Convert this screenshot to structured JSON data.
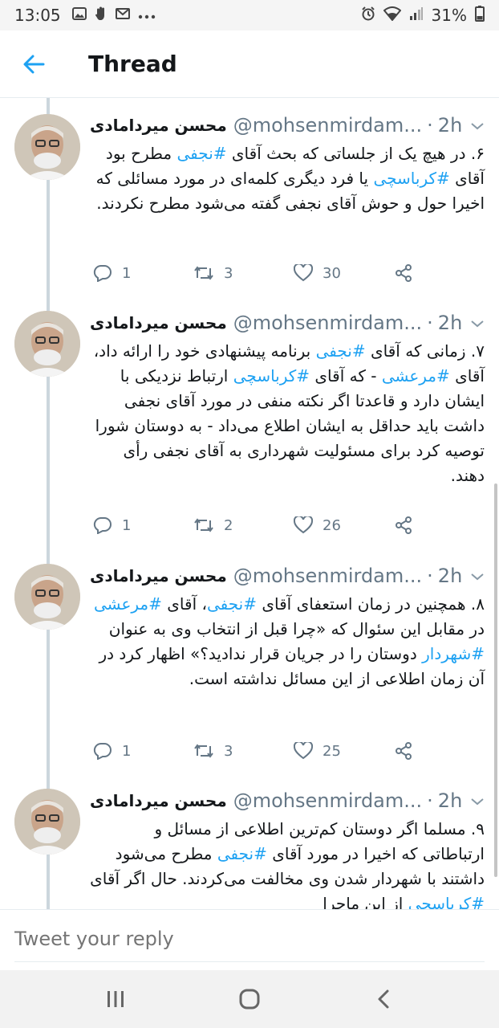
{
  "status_bar": {
    "time": "13:05",
    "battery": "31%",
    "left_icons": [
      "image-icon",
      "hand-icon",
      "gmail-icon",
      "more-icon"
    ],
    "right_icons": [
      "alarm-icon",
      "wifi-icon",
      "signal-icon",
      "battery-icon"
    ]
  },
  "header": {
    "title": "Thread"
  },
  "tweets": [
    {
      "display_name": "محسن میردامادی",
      "handle": "@mohsenmirdam...",
      "separator": "·",
      "time_ago": "2h",
      "segments": [
        {
          "text": "۶. در هیچ یک از جلساتی که بحث آقای ",
          "hashtag": false
        },
        {
          "text": "#نجفی",
          "hashtag": true
        },
        {
          "text": " مطرح بود آقای ",
          "hashtag": false
        },
        {
          "text": "#کرباسچی",
          "hashtag": true
        },
        {
          "text": " یا فرد دیگری کلمه‌ای در مورد مسائلی که اخیرا حول و حوش آقای نجفی گفته می‌شود مطرح نکردند.",
          "hashtag": false
        }
      ],
      "replies": "1",
      "retweets": "3",
      "likes": "30"
    },
    {
      "display_name": "محسن میردامادی",
      "handle": "@mohsenmirdam...",
      "separator": "·",
      "time_ago": "2h",
      "segments": [
        {
          "text": "۷. زمانی که آقای ",
          "hashtag": false
        },
        {
          "text": "#نجفی",
          "hashtag": true
        },
        {
          "text": " برنامه پیشنهادی خود را ارائه داد، آقای ",
          "hashtag": false
        },
        {
          "text": "#مرعشی",
          "hashtag": true
        },
        {
          "text": " - که آقای ",
          "hashtag": false
        },
        {
          "text": "#کرباسچی",
          "hashtag": true
        },
        {
          "text": " ارتباط نزدیکی با ایشان دارد و قاعدتا اگر نکته منفی در مورد آقای نجفی داشت باید حداقل به ایشان اطلاع می‌داد - به دوستان شورا توصیه کرد برای مسئولیت شهرداری به آقای نجفی رأی دهند.",
          "hashtag": false
        }
      ],
      "replies": "1",
      "retweets": "2",
      "likes": "26"
    },
    {
      "display_name": "محسن میردامادی",
      "handle": "@mohsenmirdam...",
      "separator": "·",
      "time_ago": "2h",
      "segments": [
        {
          "text": "۸. همچنین در زمان استعفای آقای ",
          "hashtag": false
        },
        {
          "text": "#نجفی",
          "hashtag": true
        },
        {
          "text": "، آقای ",
          "hashtag": false
        },
        {
          "text": "#مرعشی",
          "hashtag": true
        },
        {
          "text": " در مقابل این سئوال که «چرا قبل از انتخاب وی به عنوان ",
          "hashtag": false
        },
        {
          "text": "#شهردار",
          "hashtag": true
        },
        {
          "text": " دوستان را در جریان قرار ندادید؟» اظهار  کرد در آن زمان اطلاعی از این مسائل نداشته است.",
          "hashtag": false
        }
      ],
      "replies": "1",
      "retweets": "3",
      "likes": "25"
    },
    {
      "display_name": "محسن میردامادی",
      "handle": "@mohsenmirdam...",
      "separator": "·",
      "time_ago": "2h",
      "segments": [
        {
          "text": "۹. مسلما اگر دوستان کم‌ترین اطلاعی از مسائل و ارتباطاتی که اخیرا در مورد آقای ",
          "hashtag": false
        },
        {
          "text": "#نجفی",
          "hashtag": true
        },
        {
          "text": " مطرح می‌شود داشتند با شهردار شدن وی مخالفت می‌کردند. حال اگر آقای ",
          "hashtag": false
        },
        {
          "text": "#کرباسچی",
          "hashtag": true
        },
        {
          "text": " از این ماجرا",
          "hashtag": false
        }
      ],
      "replies": "",
      "retweets": "",
      "likes": ""
    }
  ],
  "reply_box": {
    "placeholder": "Tweet your reply"
  },
  "nav": {
    "items": [
      "recents-button",
      "home-button",
      "back-button"
    ]
  }
}
